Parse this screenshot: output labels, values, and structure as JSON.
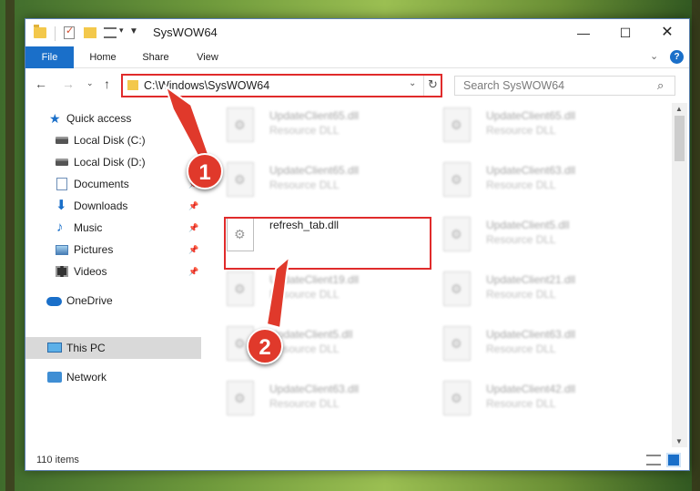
{
  "window": {
    "title": "SysWOW64",
    "controls": {
      "minimize": "—",
      "maximize": "☐",
      "close": "✕"
    }
  },
  "ribbon": {
    "tabs": [
      "File",
      "Home",
      "Share",
      "View"
    ]
  },
  "nav": {
    "address": "C:\\Windows\\SysWOW64",
    "search_placeholder": "Search SysWOW64"
  },
  "sidebar": {
    "items": [
      {
        "label": "Quick access",
        "icon": "star-icon",
        "pinned": false
      },
      {
        "label": "Local Disk (C:)",
        "icon": "disk-icon",
        "pinned": false
      },
      {
        "label": "Local Disk (D:)",
        "icon": "disk-icon",
        "pinned": false
      },
      {
        "label": "Documents",
        "icon": "documents-icon",
        "pinned": true
      },
      {
        "label": "Downloads",
        "icon": "downloads-icon",
        "pinned": true
      },
      {
        "label": "Music",
        "icon": "music-icon",
        "pinned": true
      },
      {
        "label": "Pictures",
        "icon": "pictures-icon",
        "pinned": true
      },
      {
        "label": "Videos",
        "icon": "videos-icon",
        "pinned": true
      },
      {
        "label": "OneDrive",
        "icon": "onedrive-icon",
        "pinned": false
      },
      {
        "label": "This PC",
        "icon": "pc-icon",
        "pinned": false,
        "selected": true
      },
      {
        "label": "Network",
        "icon": "network-icon",
        "pinned": false
      }
    ]
  },
  "files": {
    "column1": [
      {
        "name": "UpdateClient65.dll",
        "type": "Resource DLL"
      },
      {
        "name": "UpdateClient65.dll",
        "type": "Resource DLL"
      },
      {
        "name": "refresh_tab.dll",
        "type": ""
      },
      {
        "name": "UpdateClient19.dll",
        "type": "Resource DLL"
      },
      {
        "name": "UpdateClient5.dll",
        "type": "Resource DLL"
      },
      {
        "name": "UpdateClient63.dll",
        "type": "Resource DLL"
      }
    ],
    "column2": [
      {
        "name": "UpdateClient65.dll",
        "type": "Resource DLL"
      },
      {
        "name": "UpdateClient63.dll",
        "type": "Resource DLL"
      },
      {
        "name": "UpdateClient5.dll",
        "type": "Resource DLL"
      },
      {
        "name": "UpdateClient21.dll",
        "type": "Resource DLL"
      },
      {
        "name": "UpdateClient63.dll",
        "type": "Resource DLL"
      },
      {
        "name": "UpdateClient42.dll",
        "type": "Resource DLL"
      }
    ]
  },
  "status": {
    "count": "110 items"
  },
  "annotations": {
    "step1": "1",
    "step2": "2",
    "color": "#e0392b"
  }
}
